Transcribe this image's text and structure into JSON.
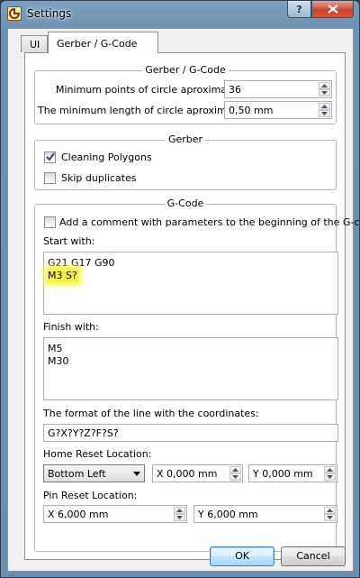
{
  "window": {
    "title": "Settings",
    "icon": "app-logo-icon",
    "help_label": "?"
  },
  "tabs": [
    {
      "label": "UI",
      "active": false
    },
    {
      "label": "Gerber / G-Code",
      "active": true
    }
  ],
  "gerber_gcode_group": {
    "title": "Gerber / G-Code",
    "min_points_label": "Minimum points of circle aproximation:",
    "min_points_value": "36",
    "min_length_label": "The minimum length of circle aproximation:",
    "min_length_value": "0,50 mm"
  },
  "gerber_group": {
    "title": "Gerber",
    "cleaning_polygons_label": "Cleaning Polygons",
    "cleaning_polygons_checked": true,
    "skip_duplicates_label": "Skip duplicates",
    "skip_duplicates_checked": false
  },
  "gcode_group": {
    "title": "G-Code",
    "add_comment_label": "Add a comment with parameters to the beginning of the G-code",
    "add_comment_checked": false,
    "start_with_label": "Start with:",
    "start_with_lines": [
      "G21 G17 G90",
      "M3 S?"
    ],
    "finish_with_label": "Finish with:",
    "finish_with_lines": [
      "M5",
      "M30"
    ],
    "coord_format_label": "The format of the line with the coordinates:",
    "coord_format_value": "G?X?Y?Z?F?S?",
    "home_reset_label": "Home Reset Location:",
    "home_reset_selected": "Bottom Left",
    "home_x_value": "X 0,000 mm",
    "home_y_value": "Y 0,000 mm",
    "pin_reset_label": "Pin Reset Location:",
    "pin_x_value": "X 6,000 mm",
    "pin_y_value": "Y 6,000 mm"
  },
  "buttons": {
    "ok_label": "OK",
    "cancel_label": "Cancel"
  },
  "colors": {
    "highlight": "#f5f53a",
    "close_button": "#c7412a",
    "title_bar": "#6d92b1"
  }
}
